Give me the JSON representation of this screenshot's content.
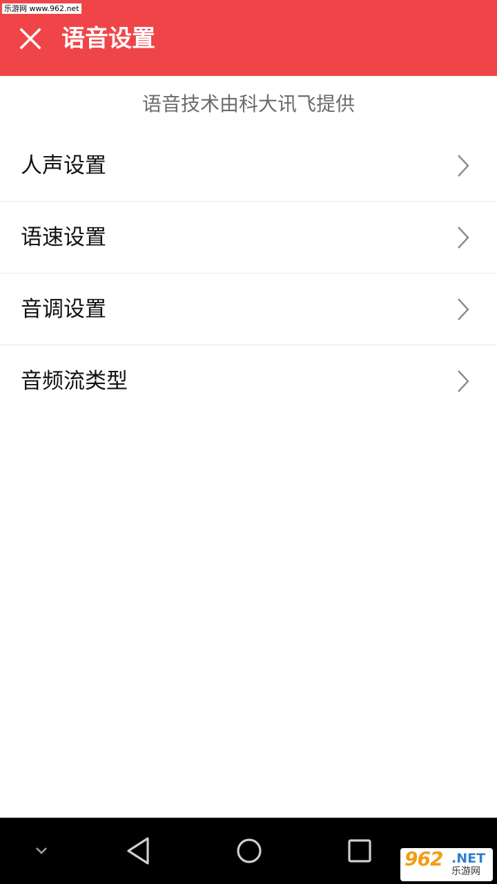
{
  "watermark": {
    "top_text": "乐游网 www.962.net"
  },
  "app_bar": {
    "title": "语音设置",
    "close_icon": "close-icon",
    "color": "#ef4549"
  },
  "provider_text": "语音技术由科大讯飞提供",
  "menu": {
    "items": [
      {
        "label": "人声设置",
        "icon": "chevron-right-icon"
      },
      {
        "label": "语速设置",
        "icon": "chevron-right-icon"
      },
      {
        "label": "音调设置",
        "icon": "chevron-right-icon"
      },
      {
        "label": "音频流类型",
        "icon": "chevron-right-icon"
      }
    ]
  },
  "nav_bar": {
    "buttons": [
      "hide-keyboard-icon",
      "back-triangle-icon",
      "home-circle-icon",
      "recents-square-icon"
    ]
  },
  "logo": {
    "main": "962",
    "net": ".NET",
    "cn": "乐游网"
  }
}
